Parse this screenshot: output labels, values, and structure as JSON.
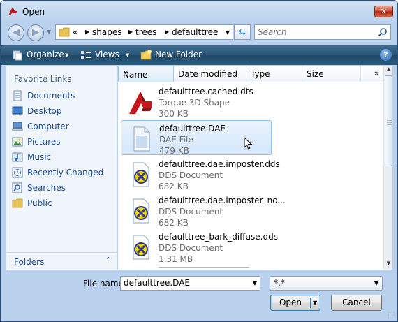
{
  "window": {
    "title": "Open"
  },
  "navigation": {
    "breadcrumb": {
      "overflow": "«",
      "segments": [
        "shapes",
        "trees",
        "defaulttree"
      ]
    },
    "search_placeholder": "Search"
  },
  "toolbar": {
    "organize": "Organize",
    "views": "Views",
    "new_folder": "New Folder",
    "help": "?"
  },
  "sidebar": {
    "header": "Favorite Links",
    "items": [
      {
        "label": "Documents",
        "icon": "documents-icon"
      },
      {
        "label": "Desktop",
        "icon": "desktop-icon"
      },
      {
        "label": "Computer",
        "icon": "computer-icon"
      },
      {
        "label": "Pictures",
        "icon": "pictures-icon"
      },
      {
        "label": "Music",
        "icon": "music-icon"
      },
      {
        "label": "Recently Changed",
        "icon": "recently-changed-icon"
      },
      {
        "label": "Searches",
        "icon": "searches-icon"
      },
      {
        "label": "Public",
        "icon": "public-folder-icon"
      }
    ],
    "folders_label": "Folders",
    "folders_chevron": "⌃"
  },
  "columns": {
    "name": "Name",
    "date_modified": "Date modified",
    "type": "Type",
    "size": "Size",
    "more": "»"
  },
  "files": [
    {
      "name": "defaulttree.cached.dts",
      "type": "Torque 3D Shape",
      "size": "300 KB",
      "icon": "torque-shape-icon",
      "selected": false
    },
    {
      "name": "defaulttree.DAE",
      "type": "DAE File",
      "size": "479 KB",
      "icon": "generic-file-icon",
      "selected": true
    },
    {
      "name": "defaulttree.dae.imposter.dds",
      "type": "DDS Document",
      "size": "682 KB",
      "icon": "dds-document-icon",
      "selected": false
    },
    {
      "name": "defaulttree.dae.imposter_no...",
      "type": "DDS Document",
      "size": "682 KB",
      "icon": "dds-document-icon",
      "selected": false
    },
    {
      "name": "defaulttree_bark_diffuse.dds",
      "type": "DDS Document",
      "size": "1.31 MB",
      "icon": "dds-document-icon",
      "selected": false
    }
  ],
  "footer": {
    "file_name_label": "File name:",
    "file_name_value": "defaulttree.DAE",
    "file_type_value": "*.*",
    "open_button": "Open",
    "cancel_button": "Cancel"
  },
  "colors": {
    "toolbar": "#2a5576",
    "link": "#1f4f93",
    "selection": "#d4e6fa",
    "close": "#c9462e"
  }
}
